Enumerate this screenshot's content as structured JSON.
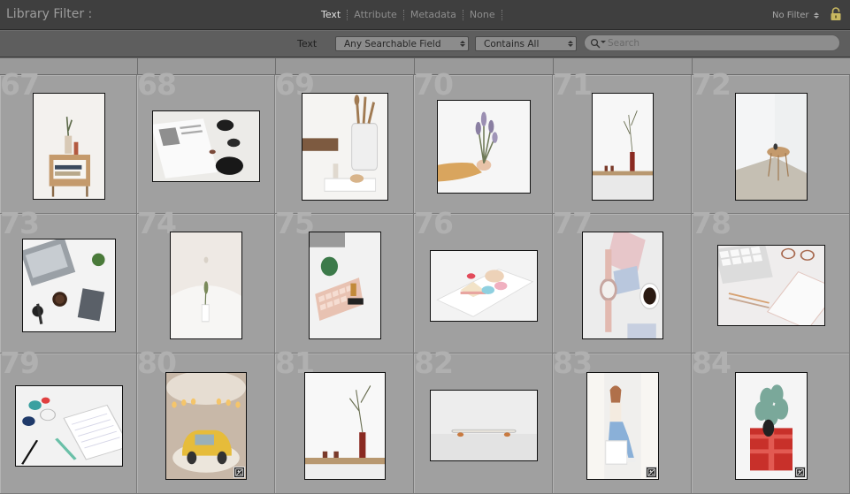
{
  "header": {
    "title": "Library Filter :",
    "modes": [
      "Text",
      "Attribute",
      "Metadata",
      "None"
    ],
    "active_mode": "Text",
    "preset": "No Filter",
    "lock_icon": "lock-icon"
  },
  "filter_bar": {
    "label": "Text",
    "field": "Any Searchable Field",
    "rule": "Contains All",
    "search_placeholder": "Search",
    "search_icon": "search-icon"
  },
  "grid": {
    "cells": [
      {
        "num": "67",
        "subject": "wooden side table with plant and books",
        "edit_badge": false
      },
      {
        "num": "68",
        "subject": "open magazine with black bowls",
        "edit_badge": false
      },
      {
        "num": "69",
        "subject": "kitchen utensils in white vase",
        "edit_badge": false
      },
      {
        "num": "70",
        "subject": "hand holding lavender bouquet",
        "edit_badge": false
      },
      {
        "num": "71",
        "subject": "single branch in red vase",
        "edit_badge": false
      },
      {
        "num": "72",
        "subject": "round side table in corner",
        "edit_badge": false
      },
      {
        "num": "73",
        "subject": "laptop, coffee and notebook flat lay",
        "edit_badge": false
      },
      {
        "num": "74",
        "subject": "white vase with flower branch",
        "edit_badge": false
      },
      {
        "num": "75",
        "subject": "pink keyboard and desk plant",
        "edit_badge": false
      },
      {
        "num": "76",
        "subject": "macarons and cake on plate",
        "edit_badge": false
      },
      {
        "num": "77",
        "subject": "watch, coffee cup and pastel papers",
        "edit_badge": false
      },
      {
        "num": "78",
        "subject": "keyboard, glasses and notebook",
        "edit_badge": false
      },
      {
        "num": "79",
        "subject": "notebook, pins and pen",
        "edit_badge": false
      },
      {
        "num": "80",
        "subject": "yellow toy car",
        "edit_badge": true
      },
      {
        "num": "81",
        "subject": "branch in red vase with cups",
        "edit_badge": false
      },
      {
        "num": "82",
        "subject": "skateboard on white floor",
        "edit_badge": false
      },
      {
        "num": "83",
        "subject": "woman in jeans sitting",
        "edit_badge": true
      },
      {
        "num": "84",
        "subject": "hydrangea in red gift box",
        "edit_badge": true
      }
    ]
  }
}
